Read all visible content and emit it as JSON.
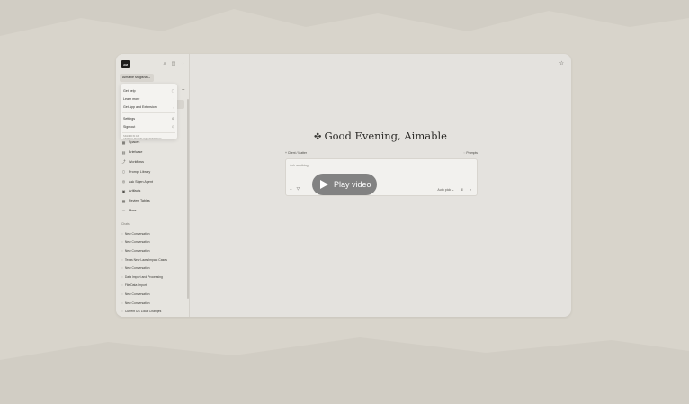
{
  "user": {
    "initials": "AM",
    "name": "Aimable Mugisha"
  },
  "menu": {
    "items": [
      {
        "label": "Get help",
        "right": "▢"
      },
      {
        "label": "Learn more",
        "right": "›"
      },
      {
        "label": "Get App and Extension",
        "right": "⤓"
      },
      {
        "label": "Settings",
        "right": "⚙"
      },
      {
        "label": "Sign out",
        "right": "⏻"
      }
    ],
    "footer": "SIGNED IN AS AIMABLE.MUGISHA@GENERICCO"
  },
  "nav": {
    "items": [
      {
        "icon": "▦",
        "label": "Spaces"
      },
      {
        "icon": "▤",
        "label": "Briefcase"
      },
      {
        "icon": "⤴",
        "label": "Workflows"
      },
      {
        "icon": "▯",
        "label": "Prompt Library"
      },
      {
        "icon": "◎",
        "label": "Ask Sigen Agent"
      },
      {
        "icon": "▣",
        "label": "Artifacts"
      },
      {
        "icon": "▦",
        "label": "Review Tables"
      },
      {
        "icon": "⋯",
        "label": "More"
      }
    ]
  },
  "chats": {
    "heading": "Chats",
    "items": [
      "New Conversation",
      "New Conversation",
      "New Conversation",
      "Texas New Laws Impact Cases",
      "New Conversation",
      "Data Import and Processing",
      "File Data Import",
      "New Conversation",
      "New Conversation",
      "Current US Local Changes"
    ]
  },
  "main": {
    "greeting": "Good Evening, Aimable",
    "client_matter": "+ Client / Matter",
    "prompts": "Prompts",
    "input_placeholder": "Ask anything...",
    "mode": "Auto pick ⌄",
    "play_label": "Play video"
  }
}
